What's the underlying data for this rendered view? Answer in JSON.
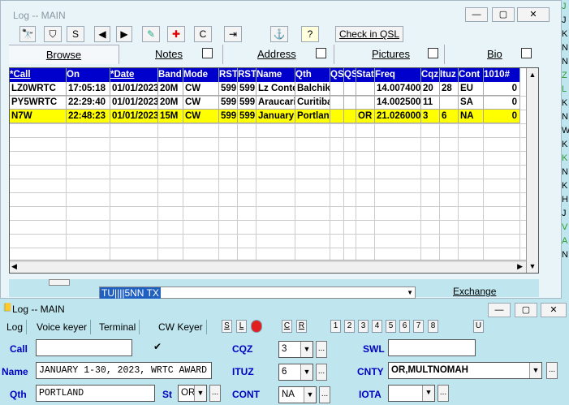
{
  "main_window": {
    "title": "Log -- MAIN",
    "minimize": "—",
    "maximize": "▢",
    "close": "✕",
    "toolbar": {
      "binoculars": "🔭",
      "filter": "⛉",
      "s": "S",
      "prev": "◀",
      "next": "▶",
      "pencil": "✎",
      "plus": "✚",
      "c": "C",
      "export": "⇥",
      "anchor": "⚓",
      "help": "?",
      "check_qsl": "Check in QSL"
    },
    "tabs": {
      "browse": "Browse",
      "notes": "Notes",
      "address": "Address",
      "pictures": "Pictures",
      "bio": "Bio"
    },
    "grid": {
      "columns": [
        "*Call",
        "On",
        "*Date",
        "Band",
        "Mode",
        "RST",
        "RST",
        "Name",
        "Qth",
        "QS",
        "QS",
        "State",
        "Freq",
        "Cqz",
        "Ituz",
        "Cont",
        "1010#"
      ],
      "rows": [
        [
          "LZ0WRTC",
          "17:05:18",
          "01/01/2023",
          "20M",
          "CW",
          "599",
          "599",
          "Lz Conte",
          "Balchik",
          "",
          "",
          "",
          "14.007400",
          "20",
          "28",
          "EU",
          "0"
        ],
        [
          "PY5WRTC",
          "22:29:40",
          "01/01/2023",
          "20M",
          "CW",
          "599",
          "599",
          "Araucari",
          "Curitiba",
          "",
          "",
          "",
          "14.002500",
          "11",
          "",
          "SA",
          "0"
        ],
        [
          "N7W",
          "22:48:23",
          "01/01/2023",
          "15M",
          "CW",
          "599",
          "599",
          "January",
          "Portland",
          "",
          "",
          "OR",
          "21.026000",
          "3",
          "6",
          "NA",
          "0"
        ]
      ]
    },
    "bottom": {
      "macro": "TU||||5NN TX",
      "exchange": "Exchange"
    }
  },
  "right_partial": [
    "J",
    "J",
    "K",
    "N",
    "N",
    "Z",
    "L",
    "K",
    "N",
    "W",
    "K",
    "K",
    "N",
    "K",
    "H",
    "J",
    "V",
    "A",
    "N"
  ],
  "log_window": {
    "title": "Log -- MAIN",
    "menu": [
      "Log",
      "Voice keyer",
      "Terminal",
      "CW Keyer"
    ],
    "small_buttons": [
      "S",
      "L",
      "C",
      "R",
      "1",
      "2",
      "3",
      "4",
      "5",
      "6",
      "7",
      "8",
      "U"
    ],
    "fields": {
      "call_label": "Call",
      "call_value": "",
      "name_label": "Name",
      "name_value": "JANUARY 1-30, 2023, WRTC AWARD",
      "qth_label": "Qth",
      "qth_value": "PORTLAND",
      "st_label": "St",
      "st_value": "OR",
      "cqz_label": "CQZ",
      "cqz_value": "3",
      "ituz_label": "ITUZ",
      "ituz_value": "6",
      "cont_label": "CONT",
      "cont_value": "NA",
      "swl_label": "SWL",
      "swl_value": "",
      "cnty_label": "CNTY",
      "cnty_value": "OR,MULTNOMAH",
      "iota_label": "IOTA",
      "iota_value": ""
    },
    "dots": "..."
  }
}
